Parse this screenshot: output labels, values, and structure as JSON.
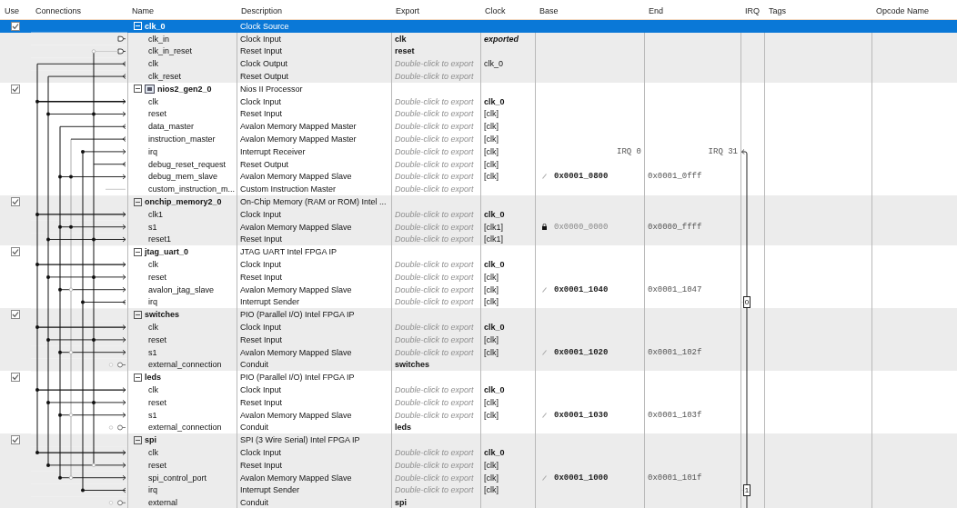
{
  "columns": [
    "Use",
    "Connections",
    "Name",
    "Description",
    "Export",
    "Clock",
    "Base",
    "End",
    "IRQ",
    "Tags",
    "Opcode Name"
  ],
  "components": [
    {
      "name": "clk_0",
      "description": "Clock Source",
      "checked": true,
      "selected": true,
      "expanded": true,
      "kind": "ip",
      "interfaces": [
        {
          "name": "clk_in",
          "description": "Clock Input",
          "export": "clk",
          "clock": "exported",
          "clock_bold": true,
          "clock_italic": true
        },
        {
          "name": "clk_in_reset",
          "description": "Reset Input",
          "export": "reset"
        },
        {
          "name": "clk",
          "description": "Clock Output",
          "export_placeholder": "Double-click to export",
          "clock": "clk_0",
          "clock_bold": false,
          "clock_italic": false
        },
        {
          "name": "clk_reset",
          "description": "Reset Output",
          "export_placeholder": "Double-click to export"
        }
      ]
    },
    {
      "name": "nios2_gen2_0",
      "description": "Nios II Processor",
      "checked": true,
      "selected": false,
      "expanded": true,
      "kind": "processor",
      "interfaces": [
        {
          "name": "clk",
          "description": "Clock Input",
          "export_placeholder": "Double-click to export",
          "clock": "clk_0",
          "clock_bold": true,
          "clock_italic": false
        },
        {
          "name": "reset",
          "description": "Reset Input",
          "export_placeholder": "Double-click to export",
          "clock": "[clk]",
          "clock_bold": false,
          "clock_italic": false
        },
        {
          "name": "data_master",
          "description": "Avalon Memory Mapped Master",
          "export_placeholder": "Double-click to export",
          "clock": "[clk]",
          "clock_bold": false,
          "clock_italic": false
        },
        {
          "name": "instruction_master",
          "description": "Avalon Memory Mapped Master",
          "export_placeholder": "Double-click to export",
          "clock": "[clk]",
          "clock_bold": false,
          "clock_italic": false
        },
        {
          "name": "irq",
          "description": "Interrupt Receiver",
          "export_placeholder": "Double-click to export",
          "clock": "[clk]",
          "clock_bold": false,
          "clock_italic": false,
          "irq_from": "IRQ 0",
          "irq_to": "IRQ 31"
        },
        {
          "name": "debug_reset_request",
          "description": "Reset Output",
          "export_placeholder": "Double-click to export",
          "clock": "[clk]",
          "clock_bold": false,
          "clock_italic": false
        },
        {
          "name": "debug_mem_slave",
          "description": "Avalon Memory Mapped Slave",
          "export_placeholder": "Double-click to export",
          "clock": "[clk]",
          "clock_bold": false,
          "clock_italic": false,
          "base": "0x0001_0800",
          "base_locked": false,
          "end": "0x0001_0fff"
        },
        {
          "name": "custom_instruction_m...",
          "description": "Custom Instruction Master",
          "export_placeholder": "Double-click to export"
        }
      ]
    },
    {
      "name": "onchip_memory2_0",
      "description": "On-Chip Memory (RAM or ROM) Intel ...",
      "checked": true,
      "selected": false,
      "expanded": true,
      "kind": "ip",
      "interfaces": [
        {
          "name": "clk1",
          "description": "Clock Input",
          "export_placeholder": "Double-click to export",
          "clock": "clk_0",
          "clock_bold": true,
          "clock_italic": false
        },
        {
          "name": "s1",
          "description": "Avalon Memory Mapped Slave",
          "export_placeholder": "Double-click to export",
          "clock": "[clk1]",
          "clock_bold": false,
          "clock_italic": false,
          "base": "0x0000_0000",
          "base_locked": true,
          "end": "0x0000_ffff"
        },
        {
          "name": "reset1",
          "description": "Reset Input",
          "export_placeholder": "Double-click to export",
          "clock": "[clk1]",
          "clock_bold": false,
          "clock_italic": false
        }
      ]
    },
    {
      "name": "jtag_uart_0",
      "description": "JTAG UART Intel FPGA IP",
      "checked": true,
      "selected": false,
      "expanded": true,
      "kind": "ip",
      "interfaces": [
        {
          "name": "clk",
          "description": "Clock Input",
          "export_placeholder": "Double-click to export",
          "clock": "clk_0",
          "clock_bold": true,
          "clock_italic": false
        },
        {
          "name": "reset",
          "description": "Reset Input",
          "export_placeholder": "Double-click to export",
          "clock": "[clk]",
          "clock_bold": false,
          "clock_italic": false
        },
        {
          "name": "avalon_jtag_slave",
          "description": "Avalon Memory Mapped Slave",
          "export_placeholder": "Double-click to export",
          "clock": "[clk]",
          "clock_bold": false,
          "clock_italic": false,
          "base": "0x0001_1040",
          "base_locked": false,
          "end": "0x0001_1047"
        },
        {
          "name": "irq",
          "description": "Interrupt Sender",
          "export_placeholder": "Double-click to export",
          "clock": "[clk]",
          "clock_bold": false,
          "clock_italic": false,
          "irq": "0"
        }
      ]
    },
    {
      "name": "switches",
      "description": "PIO (Parallel I/O) Intel FPGA IP",
      "checked": true,
      "selected": false,
      "expanded": true,
      "kind": "ip",
      "interfaces": [
        {
          "name": "clk",
          "description": "Clock Input",
          "export_placeholder": "Double-click to export",
          "clock": "clk_0",
          "clock_bold": true,
          "clock_italic": false
        },
        {
          "name": "reset",
          "description": "Reset Input",
          "export_placeholder": "Double-click to export",
          "clock": "[clk]",
          "clock_bold": false,
          "clock_italic": false
        },
        {
          "name": "s1",
          "description": "Avalon Memory Mapped Slave",
          "export_placeholder": "Double-click to export",
          "clock": "[clk]",
          "clock_bold": false,
          "clock_italic": false,
          "base": "0x0001_1020",
          "base_locked": false,
          "end": "0x0001_102f"
        },
        {
          "name": "external_connection",
          "description": "Conduit",
          "export": "switches"
        }
      ]
    },
    {
      "name": "leds",
      "description": "PIO (Parallel I/O) Intel FPGA IP",
      "checked": true,
      "selected": false,
      "expanded": true,
      "kind": "ip",
      "interfaces": [
        {
          "name": "clk",
          "description": "Clock Input",
          "export_placeholder": "Double-click to export",
          "clock": "clk_0",
          "clock_bold": true,
          "clock_italic": false
        },
        {
          "name": "reset",
          "description": "Reset Input",
          "export_placeholder": "Double-click to export",
          "clock": "[clk]",
          "clock_bold": false,
          "clock_italic": false
        },
        {
          "name": "s1",
          "description": "Avalon Memory Mapped Slave",
          "export_placeholder": "Double-click to export",
          "clock": "[clk]",
          "clock_bold": false,
          "clock_italic": false,
          "base": "0x0001_1030",
          "base_locked": false,
          "end": "0x0001_103f"
        },
        {
          "name": "external_connection",
          "description": "Conduit",
          "export": "leds"
        }
      ]
    },
    {
      "name": "spi",
      "description": "SPI (3 Wire Serial) Intel FPGA IP",
      "checked": true,
      "selected": false,
      "expanded": true,
      "kind": "ip",
      "interfaces": [
        {
          "name": "clk",
          "description": "Clock Input",
          "export_placeholder": "Double-click to export",
          "clock": "clk_0",
          "clock_bold": true,
          "clock_italic": false
        },
        {
          "name": "reset",
          "description": "Reset Input",
          "export_placeholder": "Double-click to export",
          "clock": "[clk]",
          "clock_bold": false,
          "clock_italic": false
        },
        {
          "name": "spi_control_port",
          "description": "Avalon Memory Mapped Slave",
          "export_placeholder": "Double-click to export",
          "clock": "[clk]",
          "clock_bold": false,
          "clock_italic": false,
          "base": "0x0001_1000",
          "base_locked": false,
          "end": "0x0001_101f"
        },
        {
          "name": "irq",
          "description": "Interrupt Sender",
          "export_placeholder": "Double-click to export",
          "clock": "[clk]",
          "clock_bold": false,
          "clock_italic": false,
          "irq": "1"
        },
        {
          "name": "external",
          "description": "Conduit",
          "export": "spi"
        }
      ]
    }
  ]
}
